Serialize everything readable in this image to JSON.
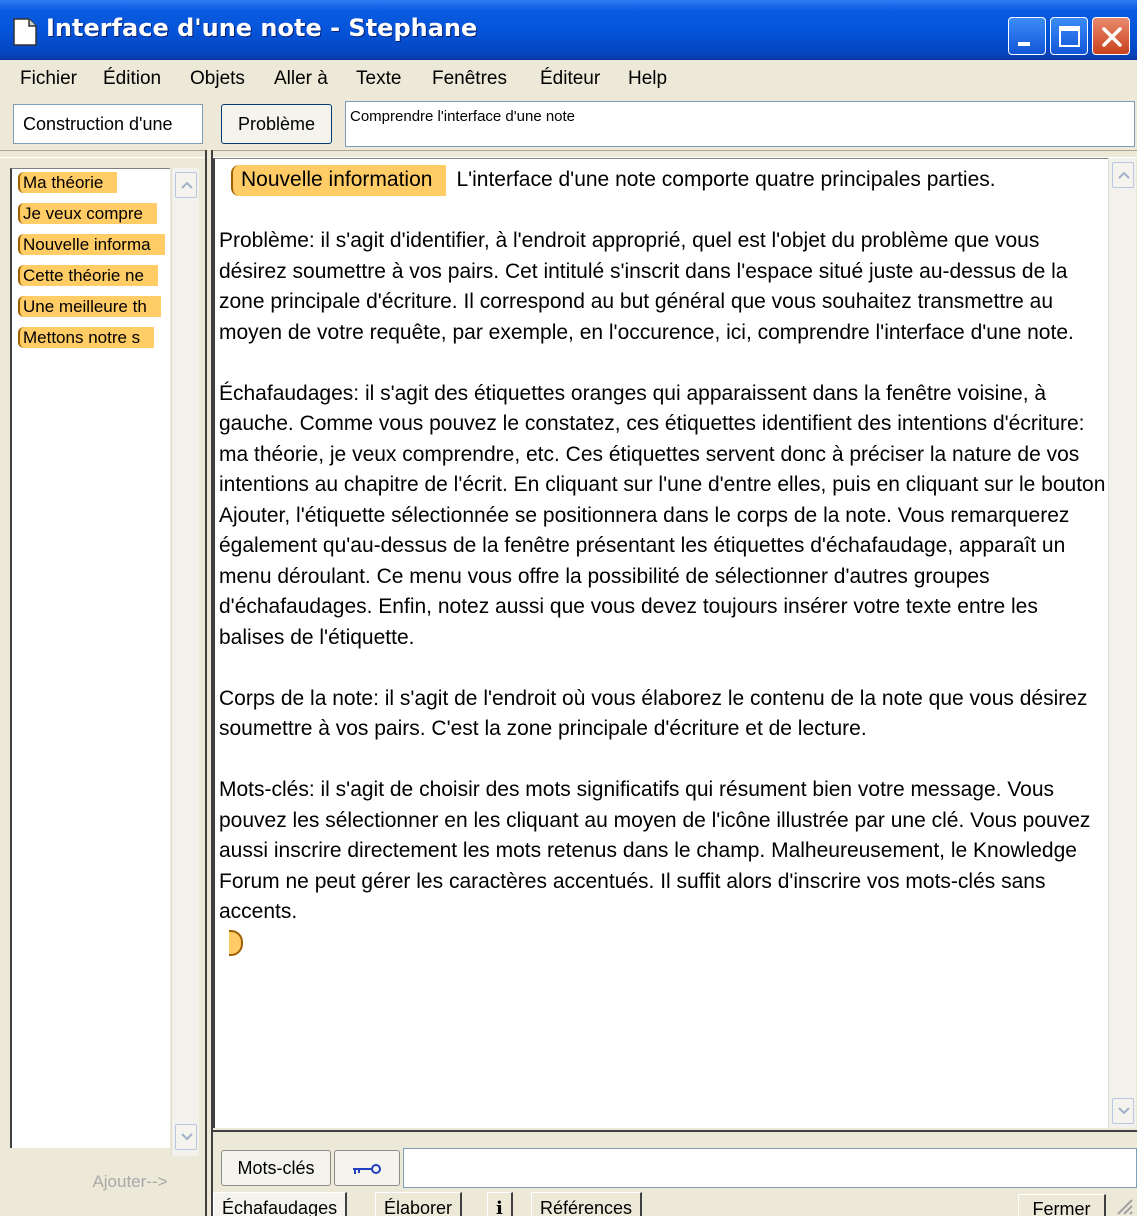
{
  "window": {
    "title": "Interface d'une note - Stephane"
  },
  "menu": [
    "Fichier",
    "Édition",
    "Objets",
    "Aller à",
    "Texte",
    "Fenêtres",
    "Éditeur",
    "Help"
  ],
  "scaffold_group": "Construction d'une",
  "problem": {
    "button_label": "Problème",
    "value": "Comprendre l'interface d'une note"
  },
  "scaffolds": [
    "Ma théorie",
    "Je veux compre",
    "Nouvelle informa",
    "Cette théorie ne",
    "Une meilleure th",
    "Mettons notre s"
  ],
  "add_button_label": "Ajouter-->",
  "note": {
    "scaffold_tag": "Nouvelle information",
    "paragraphs": [
      "L'interface d'une note comporte quatre principales parties.",
      "Problème: il s'agit d'identifier, à l'endroit approprié, quel est l'objet du problème que vous désirez soumettre à vos pairs. Cet intitulé s'inscrit dans l'espace situé juste au-dessus de la zone principale d'écriture. Il correspond au but général que vous souhaitez transmettre au moyen de votre requête, par exemple, en l'occurence, ici, comprendre l'interface d'une note.",
      "Échafaudages: il s'agit des étiquettes oranges qui apparaissent dans la fenêtre voisine, à gauche. Comme vous pouvez le constatez, ces étiquettes identifient des intentions d'écriture: ma théorie, je veux comprendre, etc. Ces étiquettes servent donc à préciser la nature de vos intentions au chapitre de l'écrit. En cliquant sur l'une d'entre elles, puis en cliquant sur le bouton Ajouter, l'étiquette sélectionnée se positionnera dans le corps de la note. Vous remarquerez également qu'au-dessus de la fenêtre présentant les étiquettes d'échafaudage, apparaît un menu déroulant. Ce menu vous offre la possibilité de sélectionner d'autres groupes d'échafaudages. Enfin, notez aussi que vous devez toujours insérer votre texte entre les balises de l'étiquette.",
      "Corps de la note: il s'agit de l'endroit où vous élaborez le contenu de la note que vous désirez soumettre à vos pairs. C'est la zone principale d'écriture et de lecture.",
      "Mots-clés: il s'agit de choisir des mots significatifs qui résument bien votre message. Vous pouvez les sélectionner en les cliquant au moyen de l'icône illustrée par une clé. Vous pouvez aussi inscrire directement les mots retenus dans le champ. Malheureusement, le Knowledge Forum ne peut gérer les caractères accentués. Il suffit alors d'inscrire vos mots-clés sans accents."
    ]
  },
  "keywords": {
    "button_label": "Mots-clés",
    "value": ""
  },
  "tabs": [
    "Échafaudages",
    "Élaborer",
    "i",
    "Références"
  ],
  "close_button_label": "Fermer",
  "colors": {
    "scaffold_orange": "#FFCC66",
    "titlebar_blue": "#0553D8"
  }
}
